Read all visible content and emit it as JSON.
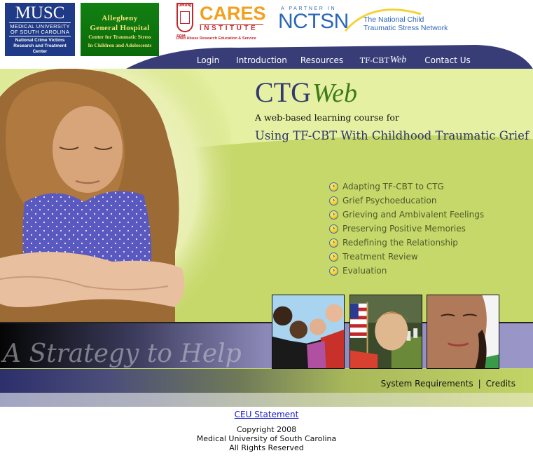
{
  "header": {
    "logos": {
      "musc": {
        "title": "MUSC",
        "subtitle": "MEDICAL UNIVERSITY OF SOUTH CAROLINA",
        "line1": "National Crime Victims",
        "line2": "Research and Treatment",
        "line3": "Center"
      },
      "allegheny": {
        "line1": "Allegheny",
        "line2": "General Hospital",
        "line3": "Center for Traumatic Stress",
        "line4": "In Children and Adolescents"
      },
      "cares": {
        "umdnj": "UMDNJ",
        "som": "SOM",
        "title": "CARES",
        "institute": "INSTITUTE",
        "tagline": "Child Abuse Research Education & Service"
      },
      "nctsn": {
        "partner": "A PARTNER IN",
        "title": "NCTSN",
        "name_line1": "The National Child",
        "name_line2": "Traumatic Stress Network"
      }
    }
  },
  "nav": {
    "items": [
      {
        "label": "Login"
      },
      {
        "label": "Introduction"
      },
      {
        "label": "Resources"
      },
      {
        "label": "TF-CBT",
        "suffix": "Web"
      },
      {
        "label": "Contact Us"
      }
    ]
  },
  "hero": {
    "title_main": "CTG",
    "title_suffix": "Web",
    "subtitle1": "A web-based learning course for",
    "subtitle2": "Using TF-CBT With Childhood Traumatic Grief",
    "bullet_glyph": "›",
    "menu": [
      {
        "label": "Adapting TF-CBT to CTG"
      },
      {
        "label": "Grief Psychoeducation"
      },
      {
        "label": "Grieving and Ambivalent Feelings"
      },
      {
        "label": "Preserving Positive Memories"
      },
      {
        "label": "Redefining the Relationship"
      },
      {
        "label": "Treatment Review"
      },
      {
        "label": "Evaluation"
      }
    ],
    "tagline": "A Strategy to Help"
  },
  "footer": {
    "system_requirements": "System Requirements",
    "separator": "|",
    "credits": "Credits",
    "ceu": "CEU Statement",
    "copyright_line1": "Copyright 2008",
    "copyright_line2": "Medical University of South Carolina",
    "copyright_line3": "All Rights Reserved"
  },
  "colors": {
    "nav_bg": "#383d78",
    "hero_green": "#c6d86a",
    "hero_light": "#e6f0a2",
    "title_blue": "#323a72",
    "title_green": "#3e7a1c",
    "band_purple": "#9a97c8",
    "link_blue": "#1a1acc"
  }
}
